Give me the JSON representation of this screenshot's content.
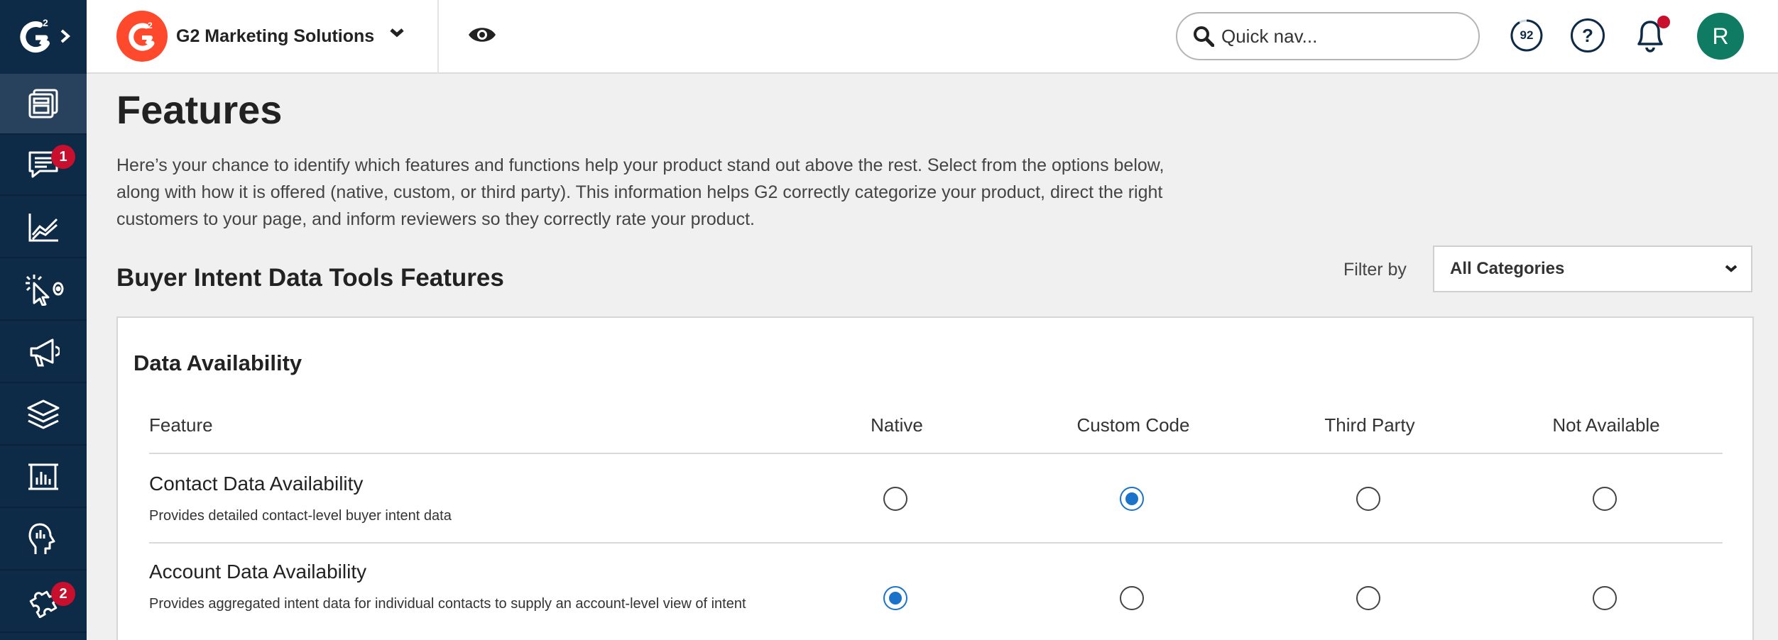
{
  "brand": {
    "sidebar_logo_text": "G2",
    "name": "G2 Marketing Solutions",
    "accent": "#ff492c"
  },
  "sidebar": {
    "items": [
      {
        "icon": "dashboard-icon",
        "active": true,
        "badge": ""
      },
      {
        "icon": "reviews-chat-icon",
        "active": false,
        "badge": "1"
      },
      {
        "icon": "analytics-chart-icon",
        "active": false,
        "badge": ""
      },
      {
        "icon": "buyer-intent-cursor-icon",
        "active": false,
        "badge": ""
      },
      {
        "icon": "megaphone-icon",
        "active": false,
        "badge": ""
      },
      {
        "icon": "layers-icon",
        "active": false,
        "badge": ""
      },
      {
        "icon": "report-frame-icon",
        "active": false,
        "badge": ""
      },
      {
        "icon": "head-insights-icon",
        "active": false,
        "badge": ""
      },
      {
        "icon": "integrations-puzzle-icon",
        "active": false,
        "badge": "2"
      }
    ]
  },
  "topbar": {
    "search_placeholder": "Quick nav...",
    "score": "92",
    "help_label": "?",
    "avatar_initial": "R"
  },
  "page": {
    "title": "Features",
    "intro": "Here’s your chance to identify which features and functions help your product stand out above the rest. Select from the options below, along with how it is offered (native, custom, or third party). This information helps G2 correctly categorize your product, direct the right customers to your page, and inform reviewers so they correctly rate your product.",
    "section_title": "Buyer Intent Data Tools Features",
    "filter_label": "Filter by",
    "filter_value": "All Categories"
  },
  "card": {
    "title": "Data Availability",
    "columns": [
      "Feature",
      "Native",
      "Custom Code",
      "Third Party",
      "Not Available"
    ],
    "rows": [
      {
        "name": "Contact Data Availability",
        "description": "Provides detailed contact-level buyer intent data",
        "selected": "Custom Code"
      },
      {
        "name": "Account Data Availability",
        "description": "Provides aggregated intent data for individual contacts to supply an account-level view of intent",
        "selected": "Native"
      }
    ]
  },
  "colors": {
    "sidebar_bg": "#0d2a47",
    "radio_selected": "#1a73c9",
    "badge": "#c8102e",
    "avatar": "#0f7b63"
  }
}
